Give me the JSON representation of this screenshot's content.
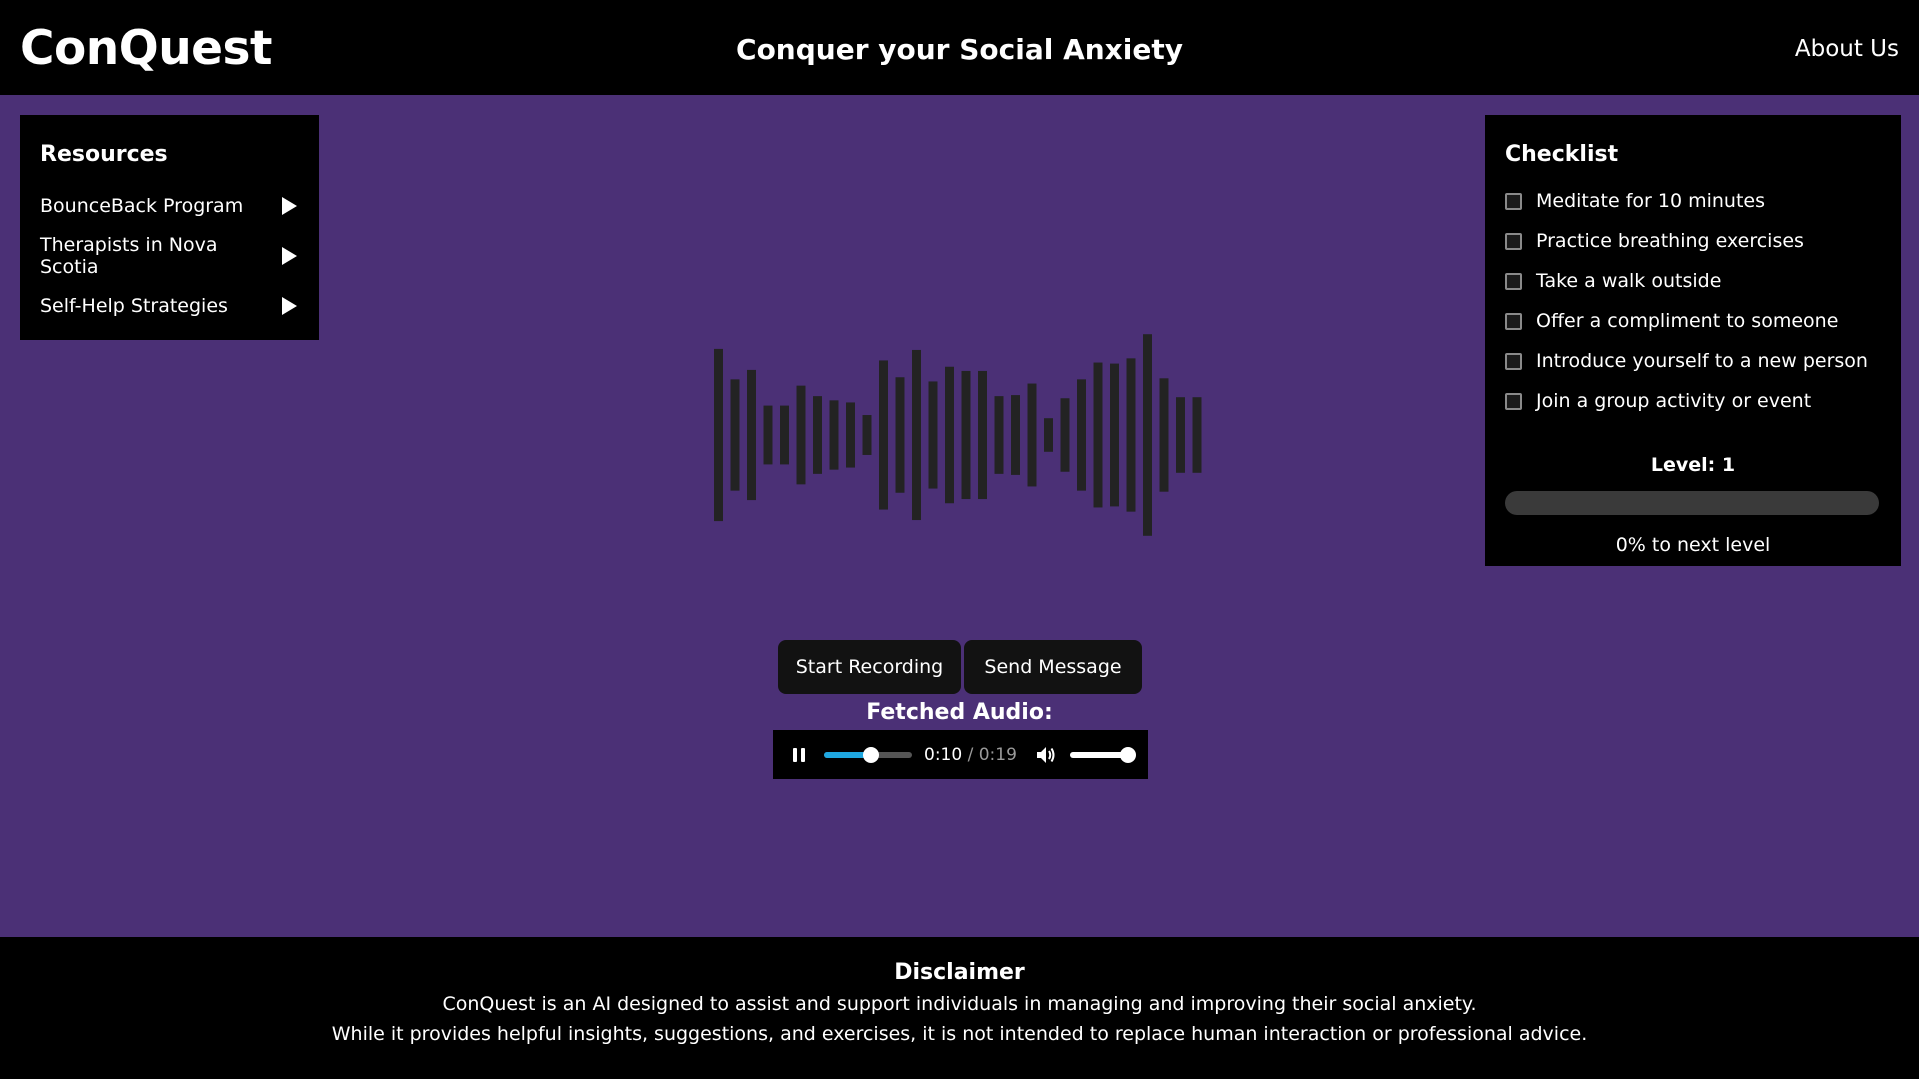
{
  "header": {
    "logo": "ConQuest",
    "tagline": "Conquer your Social Anxiety",
    "about_link": "About Us"
  },
  "resources": {
    "title": "Resources",
    "items": [
      {
        "label": "BounceBack Program",
        "icon": "play-arrow-icon"
      },
      {
        "label": "Therapists in Nova Scotia",
        "icon": "play-arrow-icon"
      },
      {
        "label": "Self-Help Strategies",
        "icon": "play-arrow-icon"
      }
    ]
  },
  "checklist": {
    "title": "Checklist",
    "items": [
      {
        "label": "Meditate for 10 minutes",
        "checked": false
      },
      {
        "label": "Practice breathing exercises",
        "checked": false
      },
      {
        "label": "Take a walk outside",
        "checked": false
      },
      {
        "label": "Offer a compliment to someone",
        "checked": false
      },
      {
        "label": "Introduce yourself to a new person",
        "checked": false
      },
      {
        "label": "Join a group activity or event",
        "checked": false
      }
    ],
    "level_label": "Level: 1",
    "progress_fraction": 0,
    "progress_text": "0% to next level"
  },
  "waveform": {
    "color": "#232323",
    "bar_levels": [
      0.82,
      0.53,
      0.62,
      0.28,
      0.28,
      0.47,
      0.37,
      0.33,
      0.31,
      0.19,
      0.71,
      0.55,
      0.81,
      0.51,
      0.65,
      0.61,
      0.61,
      0.37,
      0.38,
      0.49,
      0.16,
      0.35,
      0.53,
      0.69,
      0.68,
      0.73,
      0.96,
      0.54,
      0.36,
      0.36
    ]
  },
  "controls": {
    "start_recording": "Start Recording",
    "send_message": "Send Message"
  },
  "audio": {
    "label": "Fetched Audio:",
    "current_time": "0:10",
    "separator": " / ",
    "duration": "0:19",
    "seek_fraction": 0.53,
    "volume_fraction": 1.0,
    "accent_color": "#1fa7e0"
  },
  "footer": {
    "title": "Disclaimer",
    "line1": "ConQuest is an AI designed to assist and support individuals in managing and improving their social anxiety.",
    "line2": "While it provides helpful insights, suggestions, and exercises, it is not intended to replace human interaction or professional advice."
  },
  "colors": {
    "background": "#4b3076",
    "panel": "#000000",
    "text": "#ffffff"
  }
}
